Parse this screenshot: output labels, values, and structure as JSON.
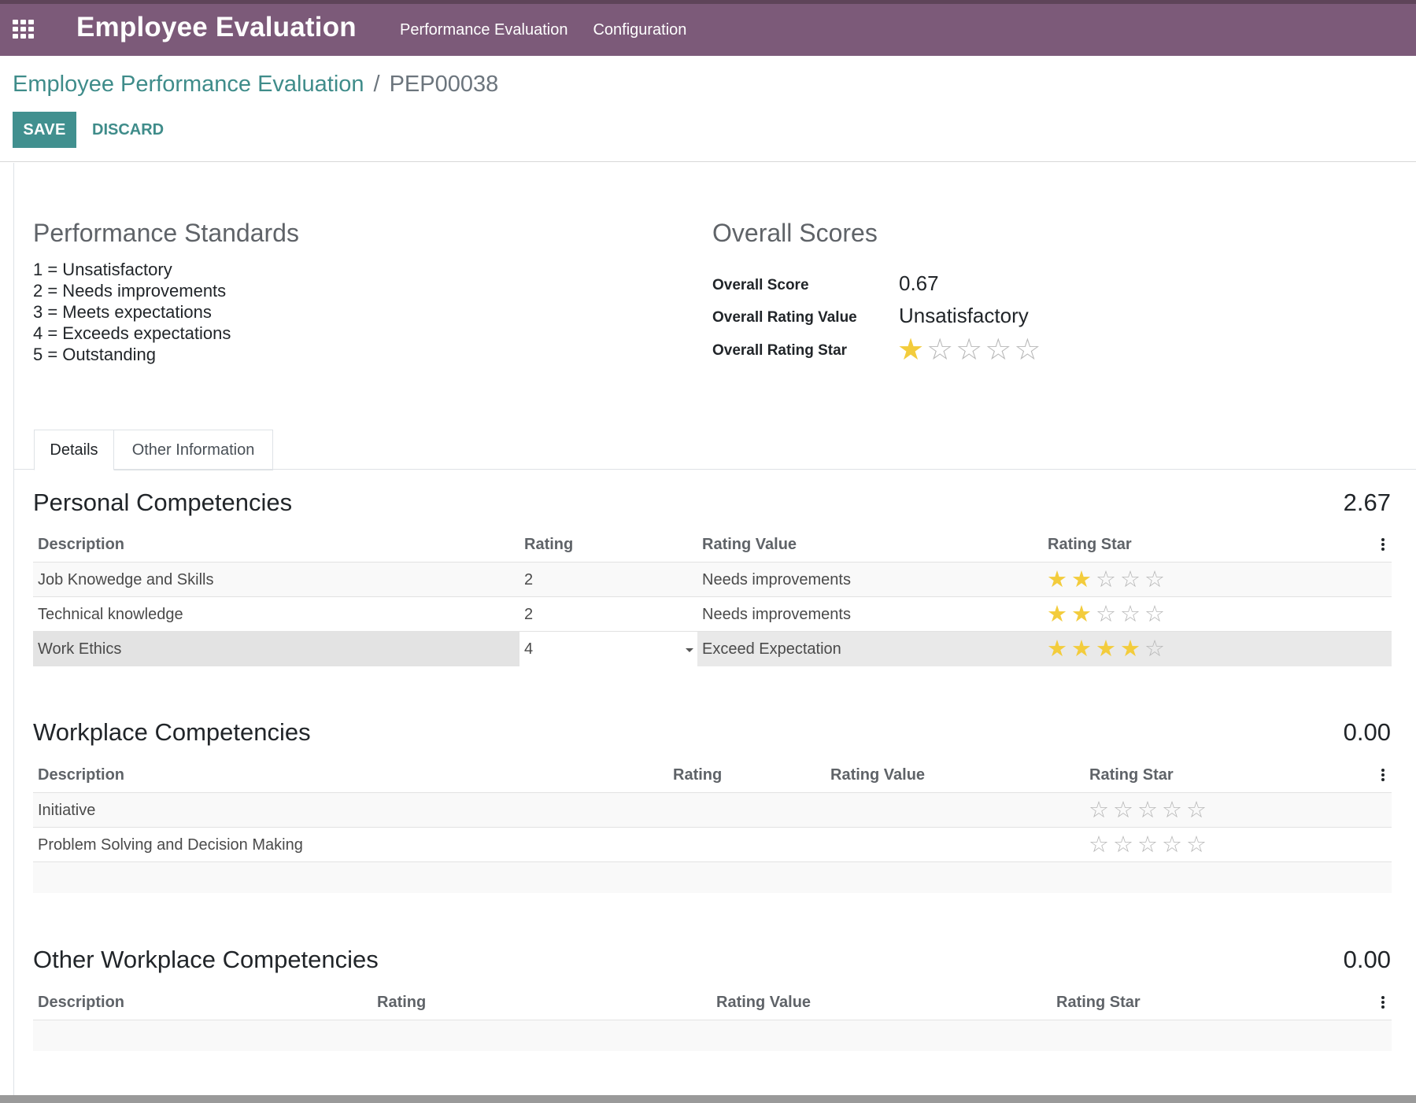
{
  "navbar": {
    "app_title": "Employee Evaluation",
    "menu": [
      "Performance Evaluation",
      "Configuration"
    ],
    "bg_color": "#7c5a79"
  },
  "breadcrumb": {
    "parent": "Employee Performance Evaluation",
    "separator": "/",
    "current": "PEP00038"
  },
  "buttons": {
    "save": "SAVE",
    "discard": "DISCARD"
  },
  "standards": {
    "title": "Performance Standards",
    "items": [
      "1 = Unsatisfactory",
      "2 = Needs improvements",
      "3 = Meets expectations",
      "4 = Exceeds expectations",
      "5 = Outstanding"
    ]
  },
  "overall": {
    "title": "Overall Scores",
    "score_label": "Overall Score",
    "score_value": "0.67",
    "rating_value_label": "Overall Rating Value",
    "rating_value": "Unsatisfactory",
    "rating_star_label": "Overall Rating Star",
    "rating_stars": 1
  },
  "tabs": [
    "Details",
    "Other Information"
  ],
  "columns": {
    "description": "Description",
    "rating": "Rating",
    "rating_value": "Rating Value",
    "rating_star": "Rating Star"
  },
  "groups": [
    {
      "title": "Personal Competencies",
      "total": "2.67",
      "rows": [
        {
          "description": "Job Knowedge and Skills",
          "rating": "2",
          "rating_value": "Needs improvements",
          "stars": 2
        },
        {
          "description": "Technical knowledge",
          "rating": "2",
          "rating_value": "Needs improvements",
          "stars": 2
        },
        {
          "description": "Work Ethics",
          "rating": "4",
          "rating_value": "Exceed Expectation",
          "stars": 4,
          "editing": true
        }
      ]
    },
    {
      "title": "Workplace Competencies",
      "total": "0.00",
      "rows": [
        {
          "description": "Initiative",
          "rating": "",
          "rating_value": "",
          "stars": 0
        },
        {
          "description": "Problem Solving and Decision Making",
          "rating": "",
          "rating_value": "",
          "stars": 0
        }
      ]
    },
    {
      "title": "Other Workplace Competencies",
      "total": "0.00",
      "rows": []
    }
  ],
  "colors": {
    "accent": "#41908f",
    "link": "#3f8c8a",
    "star_on": "#f3cc3c",
    "star_off": "#b8b8b8"
  }
}
